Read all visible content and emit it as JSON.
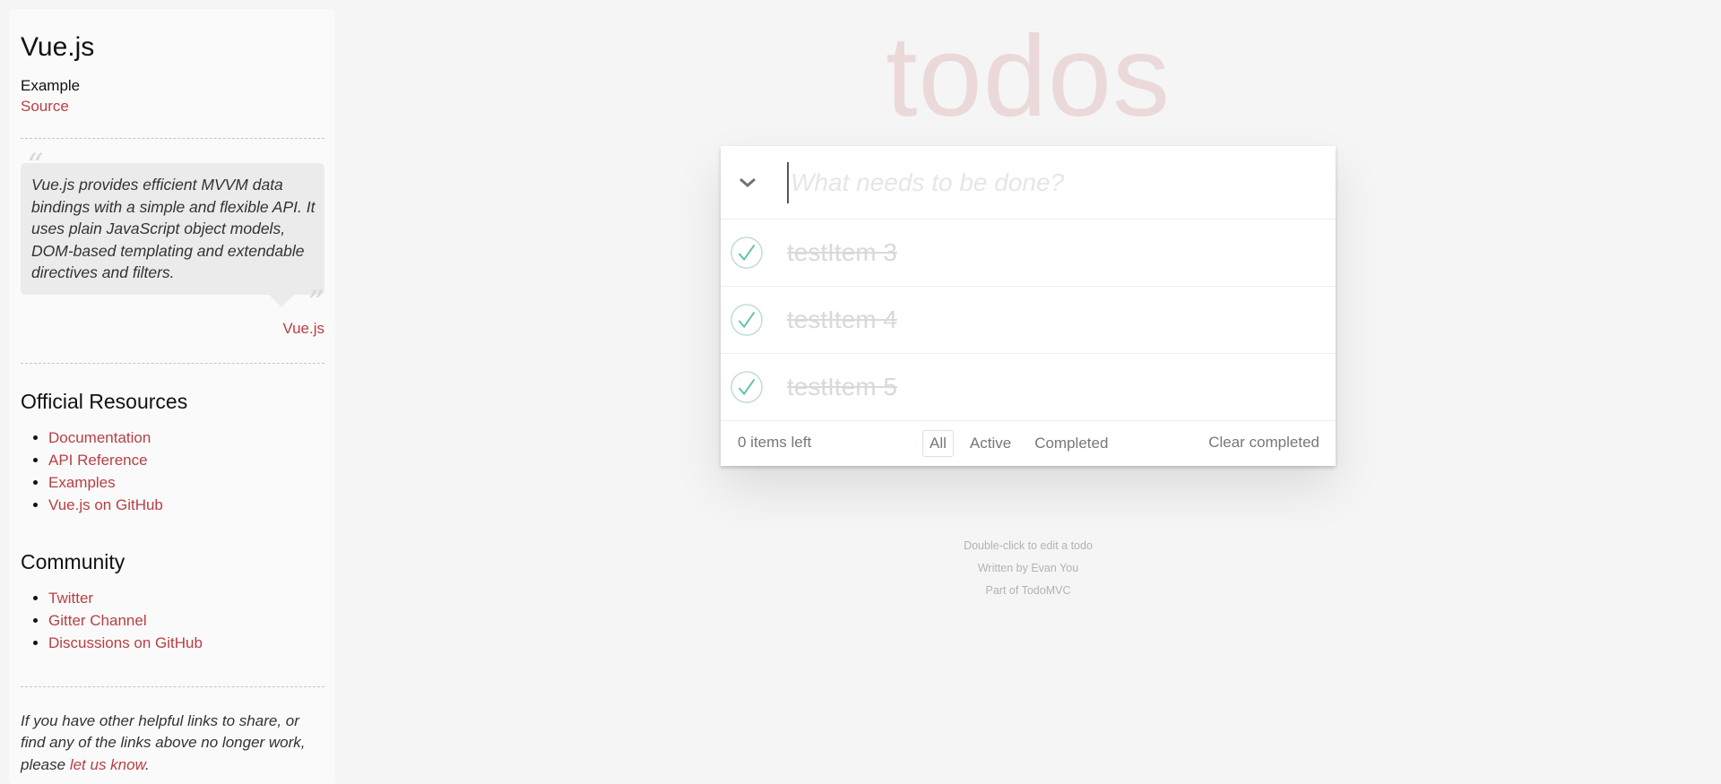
{
  "sidebar": {
    "title": "Vue.js",
    "example_label": "Example",
    "source_link": "Source",
    "quote": "Vue.js provides efficient MVVM data bindings with a simple and flexible API. It uses plain JavaScript object models, DOM-based templating and extendable directives and filters.",
    "quote_open_mark": "“",
    "quote_close_mark": "”",
    "quote_cite": "Vue.js",
    "official_resources": {
      "heading": "Official Resources",
      "links": [
        "Documentation",
        "API Reference",
        "Examples",
        "Vue.js on GitHub"
      ]
    },
    "community": {
      "heading": "Community",
      "links": [
        "Twitter",
        "Gitter Channel",
        "Discussions on GitHub"
      ]
    },
    "footer_text_before": "If you have other helpful links to share, or find any of the links above no longer work, please ",
    "footer_link": "let us know",
    "footer_text_after": "."
  },
  "app": {
    "title": "todos",
    "new_todo_placeholder": "What needs to be done?",
    "new_todo_value": "",
    "toggle_all_icon": "chevron-down-icon",
    "todos": [
      {
        "label": "testItem 3",
        "completed": true
      },
      {
        "label": "testItem 4",
        "completed": true
      },
      {
        "label": "testItem 5",
        "completed": true
      }
    ],
    "items_left": "0 items left",
    "filters": [
      "All",
      "Active",
      "Completed"
    ],
    "selected_filter": "All",
    "clear_completed": "Clear completed"
  },
  "info": {
    "hint": "Double-click to edit a todo",
    "written_by": "Written by Evan You",
    "part_of": "Part of TodoMVC"
  },
  "colors": {
    "accent": "#b83f45",
    "check": "#5dc2af",
    "page_bg": "#f5f5f5"
  }
}
